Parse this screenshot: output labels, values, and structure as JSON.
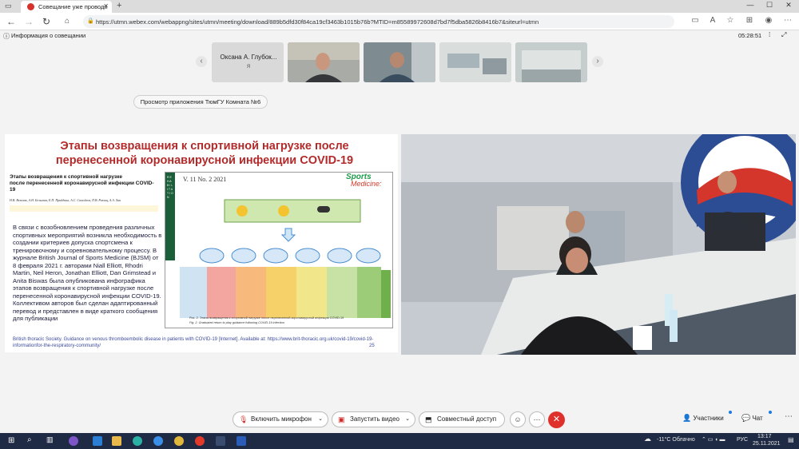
{
  "browser": {
    "tab_title": "Совещание уже проводи",
    "url": "https://utmn.webex.com/webappng/sites/utmn/meeting/download/889b5dfd30f84ca19cf3463b1015b76b?MTID=m85589972608d7bd7f5dba5826b8416b7&siteurl=utmn"
  },
  "meeting": {
    "info_label": "Информация о совещании",
    "timer": "05:28:51"
  },
  "participants": [
    {
      "name": "Оксана А. Глубок...",
      "sub": "Я"
    }
  ],
  "view_app_button": "Просмотр приложения ТюмГУ Комната №6",
  "slide": {
    "title_line1": "Этапы возвращения к спортивной нагрузке после",
    "title_line2": "перенесенной коронавирусной инфекции COVID-19",
    "inset_title_line1": "Этапы возвращения к спортивной нагрузке",
    "inset_title_line2": "после перенесенной коронавирусной инфекции COVID-19",
    "inset_authors": "Н.В. Вельчак, А.Н. Бельская, Е.П. Прийдина, А.С. Самойлов, П.В. Разлиц, А.А. Хан",
    "body_text": "В связи с возобновлением проведения различных спортивных мероприятий возникла необходимость в создании критериев допуска спортсмена к тренировочному и соревновательному процессу. В журнале British Journal of Sports Medicine (BJSM) от 8 февраля 2021 г. авторами Niall Elliott, Rhodri Martin, Neil Heron, Jonathan Elliott, Dan Grimstead и Anita Biswas была опубликована инфографика этапов возвращения к спортивной нагрузке после перенесенной коронавирусной инфекции COVID-19. Коллективом авторов был сделан адаптированный перевод и представлен в виде краткого сообщения для публикации",
    "footnote": "British thoracic Society. Guidance on venous thromboembolic disease in patients with COVID-19 [Internet]. Available at: https://www.brit-thoracic.org.uk/covid-19/covid-19-informationfor-the-respiratory-community/",
    "page_number": "25",
    "journal_issue": "V. 11 No. 2 2021",
    "journal_name_1": "Sports",
    "journal_name_2": "Medicine:",
    "side_label": "R E H A B I L I T A T I O N",
    "fig_caption_1": "Рис. 2. Этапы возвращения к спортивной нагрузке после перенесенной коронавирусной инфекции COVID-19",
    "fig_caption_2": "Fig. 2. Graduated return to play guidance following COVID-19 infection"
  },
  "controls": {
    "mic": "Включить микрофон",
    "video": "Запустить видео",
    "share": "Совместный доступ",
    "participants": "Участники",
    "chat": "Чат"
  },
  "taskbar": {
    "weather": "-11°C Облачно",
    "lang": "РУС",
    "time": "13:17",
    "date": "25.11.2021"
  },
  "colors": {
    "leave": "#e0302c",
    "slide_title": "#b22a2a",
    "taskbar": "#1f2a44"
  }
}
